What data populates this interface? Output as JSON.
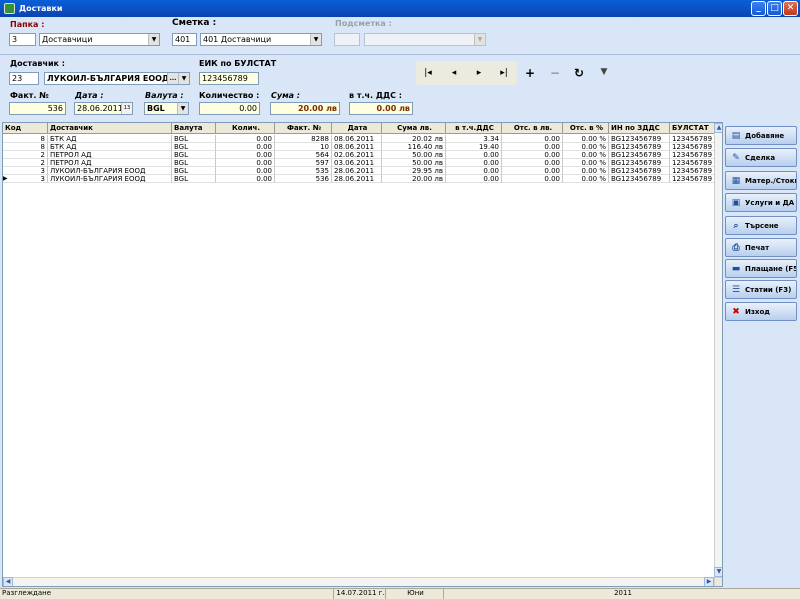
{
  "window": {
    "title": "Доставки"
  },
  "folder": {
    "label": "Папка :",
    "code": "3",
    "name": "Доставчици"
  },
  "account": {
    "label": "Сметка :",
    "code": "401",
    "name": "401 Доставчици"
  },
  "subaccount": {
    "label": "Подсметка :",
    "code": "",
    "name": ""
  },
  "supplier": {
    "label": "Доставчик :",
    "code": "23",
    "name": "ЛУКОИЛ-БЪЛГАРИЯ ЕООД",
    "browse": "..."
  },
  "eik": {
    "label": "ЕИК по БУЛСТАТ",
    "value": "123456789"
  },
  "invoice": {
    "label": "Факт. №",
    "value": "536"
  },
  "date": {
    "label": "Дата :",
    "value": "28.06.2011",
    "cal": "13"
  },
  "currency": {
    "label": "Валута :",
    "value": "BGL"
  },
  "quantity": {
    "label": "Количество :",
    "value": "0.00"
  },
  "sum": {
    "label": "Сума :",
    "value": "20.00 лв"
  },
  "vat": {
    "label": "в т.ч. ДДС :",
    "value": "0.00 лв"
  },
  "nav": {
    "first": "|◂",
    "prev": "◂",
    "next": "▸",
    "last": "▸|",
    "add": "+",
    "remove": "−",
    "refresh": "↻",
    "filter": "▼"
  },
  "table": {
    "headers": [
      "Код",
      "Доставчик",
      "Валута",
      "Колич.",
      "Факт. №",
      "Дата",
      "Сума лв.",
      "в т.ч.ДДС",
      "Отс. в лв.",
      "Отс. в %",
      "ИН по ЗДДС",
      "БУЛСТАТ"
    ],
    "rows": [
      [
        "8",
        "БТК АД",
        "BGL",
        "0.00",
        "8288",
        "08.06.2011",
        "20.02 лв",
        "3.34",
        "0.00",
        "0.00 %",
        "BG123456789",
        "123456789"
      ],
      [
        "8",
        "БТК АД",
        "BGL",
        "0.00",
        "10",
        "08.06.2011",
        "116.40 лв",
        "19.40",
        "0.00",
        "0.00 %",
        "BG123456789",
        "123456789"
      ],
      [
        "2",
        "ПЕТРОЛ АД",
        "BGL",
        "0.00",
        "564",
        "02.06.2011",
        "50.00 лв",
        "0.00",
        "0.00",
        "0.00 %",
        "BG123456789",
        "123456789"
      ],
      [
        "2",
        "ПЕТРОЛ АД",
        "BGL",
        "0.00",
        "597",
        "03.06.2011",
        "50.00 лв",
        "0.00",
        "0.00",
        "0.00 %",
        "BG123456789",
        "123456789"
      ],
      [
        "3",
        "ЛУКОИЛ-БЪЛГАРИЯ ЕООД",
        "BGL",
        "0.00",
        "535",
        "28.06.2011",
        "29.95 лв",
        "0.00",
        "0.00",
        "0.00 %",
        "BG123456789",
        "123456789"
      ],
      [
        "3",
        "ЛУКОИЛ-БЪЛГАРИЯ ЕООД",
        "BGL",
        "0.00",
        "536",
        "28.06.2011",
        "20.00 лв",
        "0.00",
        "0.00",
        "0.00 %",
        "BG123456789",
        "123456789"
      ]
    ],
    "current_row": 5,
    "current_marker": "▶"
  },
  "sidebar": {
    "items": [
      {
        "label": "Добавяне",
        "icon": "add-doc-icon"
      },
      {
        "label": "Сделка",
        "icon": "deal-icon"
      },
      {
        "label": "Матер./Стоки",
        "icon": "goods-icon"
      },
      {
        "label": "Услуги и ДА",
        "icon": "services-icon"
      },
      {
        "label": "Търсене",
        "icon": "search-icon"
      },
      {
        "label": "Печат",
        "icon": "print-icon"
      },
      {
        "label": "Плащане (F5)",
        "icon": "payment-icon"
      },
      {
        "label": "Статии (F3)",
        "icon": "entries-icon"
      },
      {
        "label": "Изход",
        "icon": "exit-icon"
      }
    ]
  },
  "status": {
    "mode": "Разглеждане",
    "date": "14.07.2011 г.",
    "month": "Юни",
    "year": "2011"
  },
  "colors": {
    "accent": "#0b4fc2",
    "panel": "#d9e6f7",
    "red_label": "#8b0000",
    "exit_red": "#cc0000"
  }
}
